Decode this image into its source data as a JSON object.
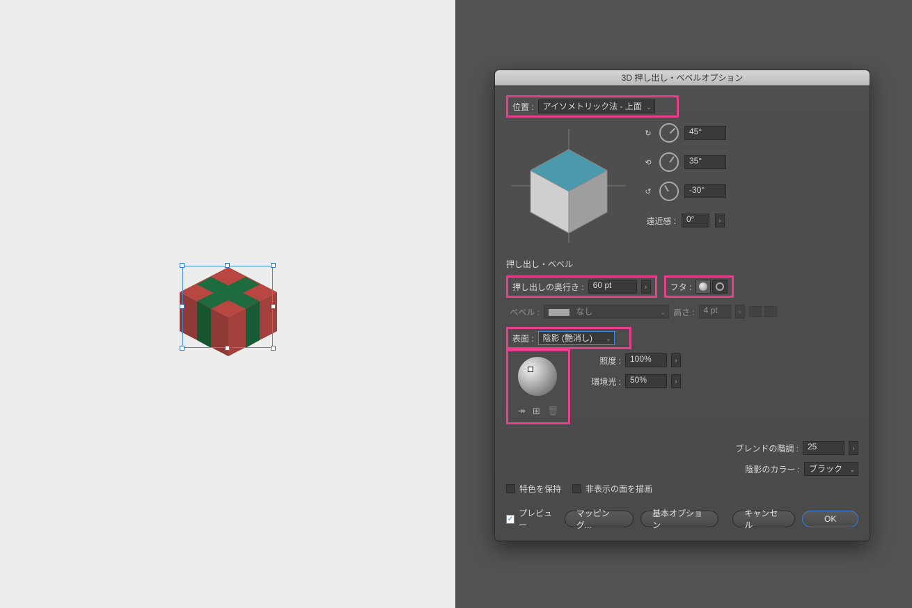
{
  "dialog": {
    "title": "3D 押し出し・ベベルオプション",
    "position_label": "位置 :",
    "position_value": "アイソメトリック法 - 上面",
    "rotations": {
      "x": "45°",
      "y": "35°",
      "z": "-30°"
    },
    "perspective_label": "遠近感 :",
    "perspective_value": "0°",
    "extrude_section": "押し出し・ベベル",
    "extrude_depth_label": "押し出しの奥行き :",
    "extrude_depth_value": "60 pt",
    "cap_label": "フタ :",
    "bevel_label": "ベベル :",
    "bevel_value": "なし",
    "bevel_height_label": "高さ :",
    "bevel_height_value": "4 pt",
    "surface_label": "表面 :",
    "surface_value": "陰影 (艶消し)",
    "light_intensity_label": "照度 :",
    "light_intensity_value": "100%",
    "ambient_label": "環境光 :",
    "ambient_value": "50%",
    "blend_steps_label": "ブレンドの階調 :",
    "blend_steps_value": "25",
    "shade_color_label": "陰影のカラー :",
    "shade_color_value": "ブラック",
    "preserve_spot": "特色を保持",
    "draw_hidden": "非表示の面を描画",
    "preview": "プレビュー",
    "map_art": "マッピング...",
    "more_options": "基本オプション",
    "cancel": "キャンセル",
    "ok": "OK"
  }
}
